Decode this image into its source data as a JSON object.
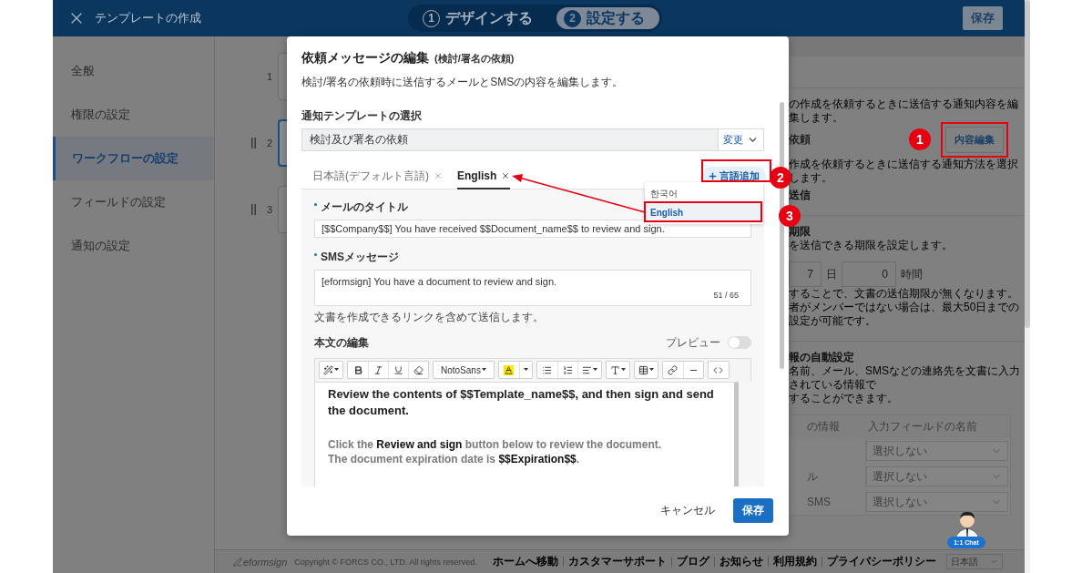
{
  "header": {
    "title": "テンプレートの作成",
    "steps": [
      {
        "number": "1",
        "label": "デザインする",
        "selected": false
      },
      {
        "number": "2",
        "label": "設定する",
        "selected": true
      }
    ],
    "save_button": "保存"
  },
  "sidebar": {
    "items": [
      {
        "label": "全般",
        "selected": false
      },
      {
        "label": "権限の設定",
        "selected": false
      },
      {
        "label": "ワークフローの設定",
        "selected": true
      },
      {
        "label": "フィールドの設定",
        "selected": false
      },
      {
        "label": "通知の設定",
        "selected": false
      }
    ]
  },
  "workflow_steps": [
    {
      "number": "1",
      "handle": false,
      "selected": false
    },
    {
      "number": "2",
      "handle": true,
      "selected": true
    },
    {
      "number": "3",
      "handle": true,
      "selected": false
    }
  ],
  "settings_panel": {
    "blocks": [
      {
        "kind": "text",
        "text": "の作成を依頼するときに送信する通知内容を編集します。"
      },
      {
        "kind": "row",
        "label": "依頼",
        "button": "内容編集"
      },
      {
        "kind": "text",
        "text": "作成を依頼するときに送信する通知方法を選択します。"
      },
      {
        "kind": "heading",
        "text": "送信"
      },
      {
        "kind": "divider"
      },
      {
        "kind": "heading",
        "text": "期限"
      },
      {
        "kind": "text",
        "text": "を送信できる期限を設定します。"
      },
      {
        "kind": "duration",
        "days": "7",
        "days_unit": "日",
        "hours": "0",
        "hours_unit": "時間"
      },
      {
        "kind": "text",
        "text": "することで、文書の送信期限が無くなります。"
      },
      {
        "kind": "text",
        "text": "者がメンバーではない場合は、最大50日までの設定が可能です。"
      },
      {
        "kind": "divider"
      },
      {
        "kind": "heading",
        "text": "報の自動設定"
      },
      {
        "kind": "text",
        "text": "名前、メール、SMSなどの連絡先を文書に入力されている情報で"
      },
      {
        "kind": "text",
        "text": "することができます。"
      },
      {
        "kind": "table",
        "columns": [
          "の情報",
          "入力フィールドの名前"
        ],
        "rows": [
          {
            "select": "選択しない"
          },
          {
            "label": "ル",
            "select": "選択しない"
          },
          {
            "label": "SMS",
            "select": "選択しない"
          }
        ]
      }
    ]
  },
  "dialog": {
    "title": "依頼メッセージの編集",
    "title_note": "(検討/署名の依頼)",
    "description": "検討/署名の依頼時に送信するメールとSMSの内容を編集します。",
    "template_label": "通知テンプレートの選択",
    "template_value": "検討及び署名の依頼",
    "change_button": "変更",
    "language_tabs": [
      {
        "label": "日本語(デフォルト言語)",
        "selected": false
      },
      {
        "label": "English",
        "selected": true
      }
    ],
    "add_language_button": "言語追加",
    "language_menu": [
      {
        "label": "한국어",
        "selected": false
      },
      {
        "label": "English",
        "selected": true
      }
    ],
    "mail_title_label": "メールのタイトル",
    "mail_title_value": "[$$Company$$] You have received $$Document_name$$ to review and sign.",
    "sms_label": "SMSメッセージ",
    "sms_value": "[eformsign] You have a document to review and sign.",
    "sms_counter": "51 / 65",
    "sms_hint": "文書を作成できるリンクを含めて送信します。",
    "body_label": "本文の編集",
    "preview_label": "プレビュー",
    "preview_on": false,
    "font_name": "NotoSans",
    "body_paragraphs": [
      {
        "kind": "heading",
        "text": "Review the contents of $$Template_name$$, and then sign and send the document."
      },
      {
        "kind": "note",
        "text": "Click the **Review and sign** button below to review the document."
      },
      {
        "kind": "note",
        "text": "The document expiration date is **$$Expiration$$**."
      }
    ],
    "cancel_button": "キャンセル",
    "save_button": "保存"
  },
  "annotations": {
    "markers": [
      "1",
      "2",
      "3"
    ]
  },
  "chat_widget": {
    "label": "1:1 Chat"
  },
  "footer": {
    "logo": "eformsign",
    "copyright": "Copyright © FORCS CO., LTD. All rights reserved.",
    "links": [
      "ホームへ移動",
      "カスタマーサポート",
      "ブログ",
      "お知らせ",
      "利用規約",
      "プライバシーポリシー"
    ],
    "language": "日本語"
  }
}
